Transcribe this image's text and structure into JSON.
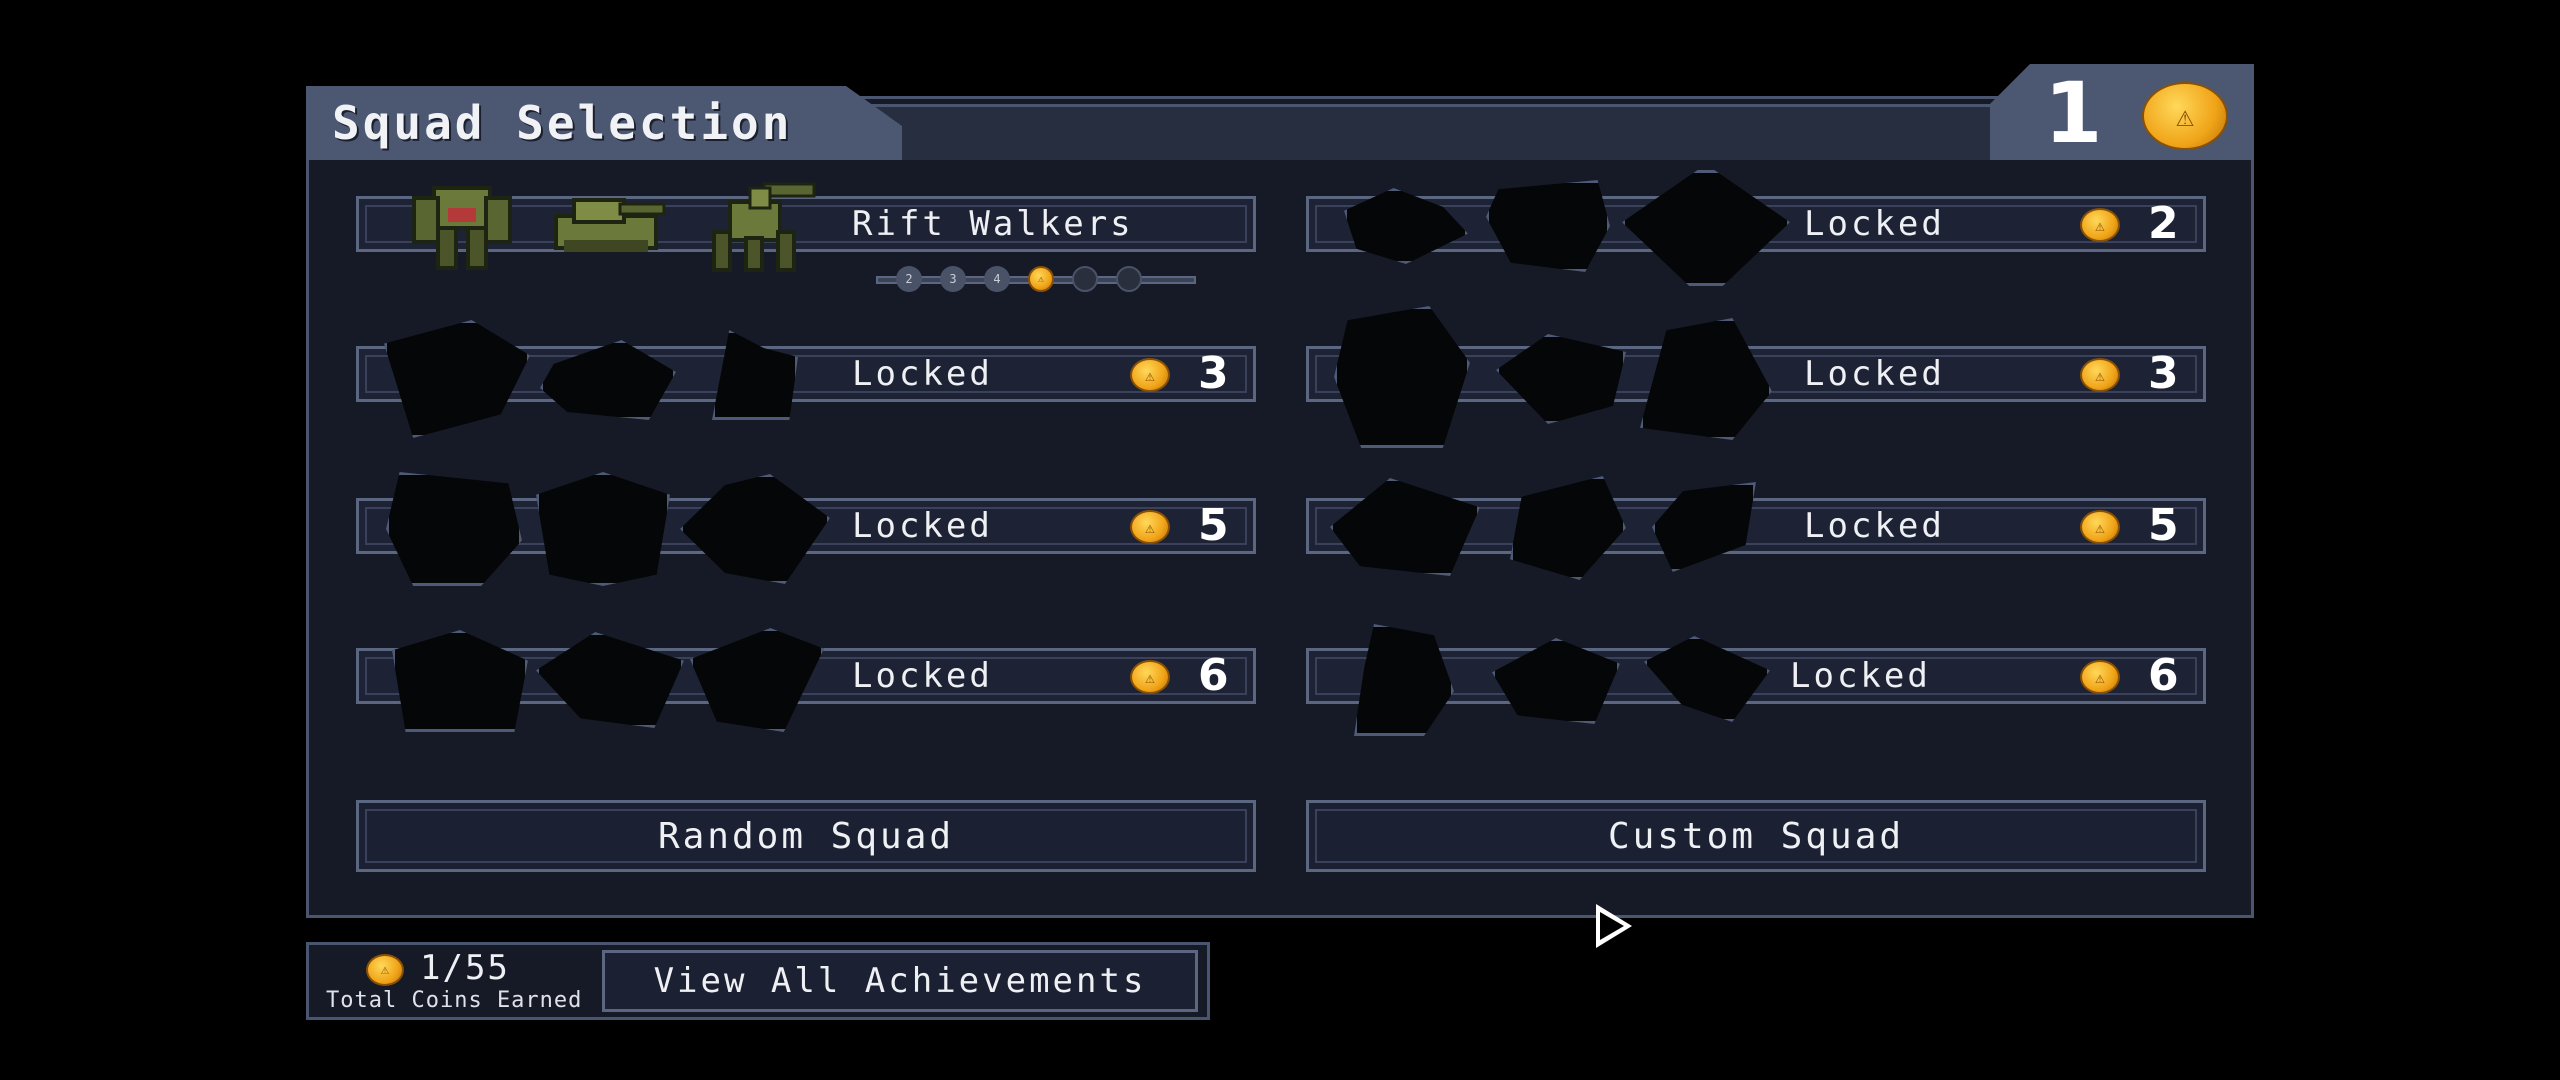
{
  "title": "Squad Selection",
  "coin_balance": "1",
  "squads": [
    {
      "name": "Rift Walkers",
      "cost": "",
      "locked": false
    },
    {
      "name": "Locked",
      "cost": "2",
      "locked": true
    },
    {
      "name": "Locked",
      "cost": "3",
      "locked": true
    },
    {
      "name": "Locked",
      "cost": "3",
      "locked": true
    },
    {
      "name": "Locked",
      "cost": "5",
      "locked": true
    },
    {
      "name": "Locked",
      "cost": "5",
      "locked": true
    },
    {
      "name": "Locked",
      "cost": "6",
      "locked": true
    },
    {
      "name": "Locked",
      "cost": "6",
      "locked": true
    }
  ],
  "medals": [
    "2",
    "3",
    "4"
  ],
  "buttons": {
    "random": "Random Squad",
    "custom": "Custom Squad",
    "achievements": "View All Achievements"
  },
  "footer": {
    "coins_earned": "1/55",
    "coins_label": "Total Coins Earned"
  },
  "colors": {
    "panel_bg": "#161a27",
    "border": "#5b6680",
    "coin": "#f0a418",
    "mech_green": "#6b7a3a"
  }
}
